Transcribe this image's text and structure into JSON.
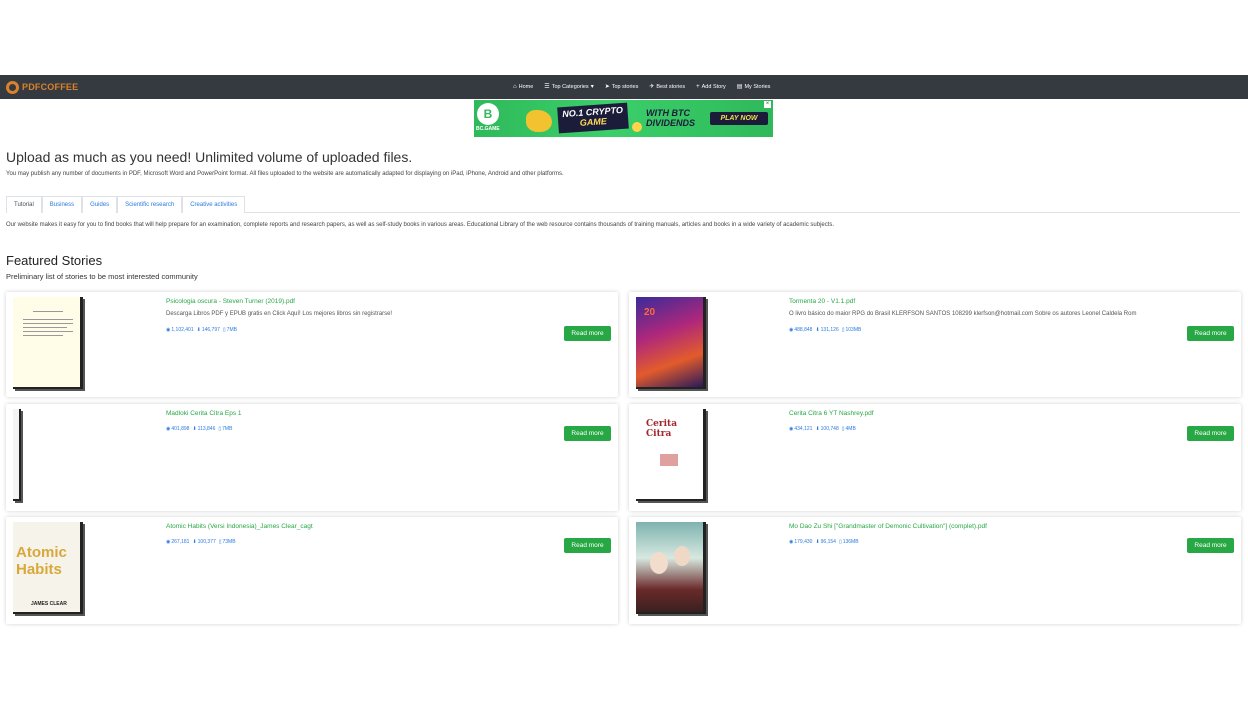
{
  "brand": {
    "name": "PDFCOFFEE"
  },
  "nav": {
    "items": [
      {
        "label": "Home",
        "icon": "home-icon"
      },
      {
        "label": "Top Categories",
        "icon": "list-icon"
      },
      {
        "label": "Top stories",
        "icon": "paper-plane-icon"
      },
      {
        "label": "Best stories",
        "icon": "rocket-icon"
      },
      {
        "label": "Add Story",
        "icon": "plus-icon"
      },
      {
        "label": "My Stories",
        "icon": "file-icon"
      }
    ]
  },
  "banner": {
    "logo": "B",
    "brand": "BC.GAME",
    "line1": "NO.1 CRYPTO",
    "line2": "GAME",
    "line3": "WITH BTC",
    "line4": "DIVIDENDS",
    "cta": "PLAY NOW",
    "colors": {
      "background": "#2fb95a",
      "dark": "#1b1b3a",
      "accent": "#f4e04d"
    }
  },
  "upload": {
    "title": "Upload as much as you need! Unlimited volume of uploaded files.",
    "text": "You may publish any number of documents in PDF, Microsoft Word and PowerPoint format. All files uploaded to the website are automatically adapted for displaying on iPad, iPhone, Android and other platforms."
  },
  "tabs": [
    "Tutorial",
    "Business",
    "Guides",
    "Scientific research",
    "Creative activities"
  ],
  "intro": {
    "text": "Our website makes it easy for you to find books that will help prepare for an examination, complete reports and research papers, as well as self-study books in various areas. Educational Library of the web resource contains thousands of training manuals, articles and books in a wide variety of academic subjects."
  },
  "featured": {
    "title": "Featured Stories",
    "subtitle": "Preliminary list of stories to be most interested community",
    "read_more": "Read more",
    "stories": [
      {
        "title": "Psicologia oscura - Steven Turner (2019).pdf",
        "description": "Descarga Libros PDF y EPUB gratis en Click Aquí! Los mejores libros sin registrarse!",
        "views": "1,102,401",
        "downloads": "146,797",
        "size": "7MB"
      },
      {
        "title": "Tormenta 20 - V1.1.pdf",
        "description": "O livro básico do maior RPG do Brasil KLERFSON SANTOS 108299 klerfson@hotmail.com Sobre os autores Leonel Caldela Rom",
        "views": "488,848",
        "downloads": "131,126",
        "size": "103MB"
      },
      {
        "title": "Madloki Cerita Citra Eps 1",
        "description": "",
        "views": "401,898",
        "downloads": "113,846",
        "size": "7MB"
      },
      {
        "title": "Cerita Citra 6 YT Nashrey.pdf",
        "description": "",
        "views": "434,121",
        "downloads": "100,748",
        "size": "4MB"
      },
      {
        "title": "Atomic Habits (Versi Indonesia)_James Clear_cagt",
        "description": "",
        "views": "267,181",
        "downloads": "100,377",
        "size": "73MB"
      },
      {
        "title": "Mo Dao Zu Shi [\"Grandmaster of Demonic Cultivation\"] (complet).pdf",
        "description": "",
        "views": "179,430",
        "downloads": "96,154",
        "size": "136MB"
      }
    ]
  },
  "covers": {
    "tormenta": "20",
    "cinta": "Cerita Citra",
    "atomic_line1": "Atomic",
    "atomic_line2": "Habits",
    "atomic_author": "JAMES CLEAR"
  },
  "colors": {
    "navbar": "#343a40",
    "brand": "#d9822b",
    "link": "#2a7ae2",
    "success": "#28a745"
  }
}
